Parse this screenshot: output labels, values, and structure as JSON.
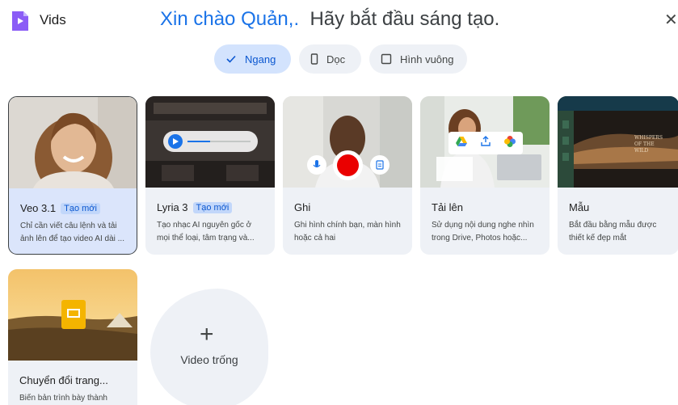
{
  "app": {
    "name": "Vids"
  },
  "greeting": {
    "hello": "Xin chào Quản,.",
    "rest": "Hãy bắt đầu sáng tạo."
  },
  "orientation": [
    {
      "label": "Ngang",
      "icon": "checkmark-icon",
      "selected": true
    },
    {
      "label": "Dọc",
      "icon": "portrait-icon",
      "selected": false
    },
    {
      "label": "Hình vuông",
      "icon": "square-icon",
      "selected": false
    }
  ],
  "cards": [
    {
      "title": "Veo 3.1",
      "badge": "Tạo mới",
      "desc": "Chỉ cần viết câu lệnh và tải ảnh lên để tạo video AI dài ..."
    },
    {
      "title": "Lyria 3",
      "badge": "Tạo mới",
      "desc": "Tạo nhạc AI nguyên gốc ở mọi thể loại, tâm trạng và..."
    },
    {
      "title": "Ghi",
      "desc": "Ghi hình chính bạn, màn hình hoặc cả hai"
    },
    {
      "title": "Tải lên",
      "desc": "Sử dụng nội dung nghe nhìn trong Drive, Photos hoặc..."
    },
    {
      "title": "Mẫu",
      "desc": "Bắt đầu bằng mẫu được thiết kế đẹp mắt",
      "thumb_text": "WHISPERS OF THE WILD"
    },
    {
      "title": "Chuyển đổi trang...",
      "desc": "Biến bản trình bày thành"
    }
  ],
  "blank": {
    "plus": "+",
    "label": "Video trống"
  },
  "colors": {
    "accent": "#1a73e8",
    "selected_chip": "#d3e3fd",
    "card_bg": "#eef1f6",
    "record": "#ea0000",
    "slides": "#f4b400"
  }
}
